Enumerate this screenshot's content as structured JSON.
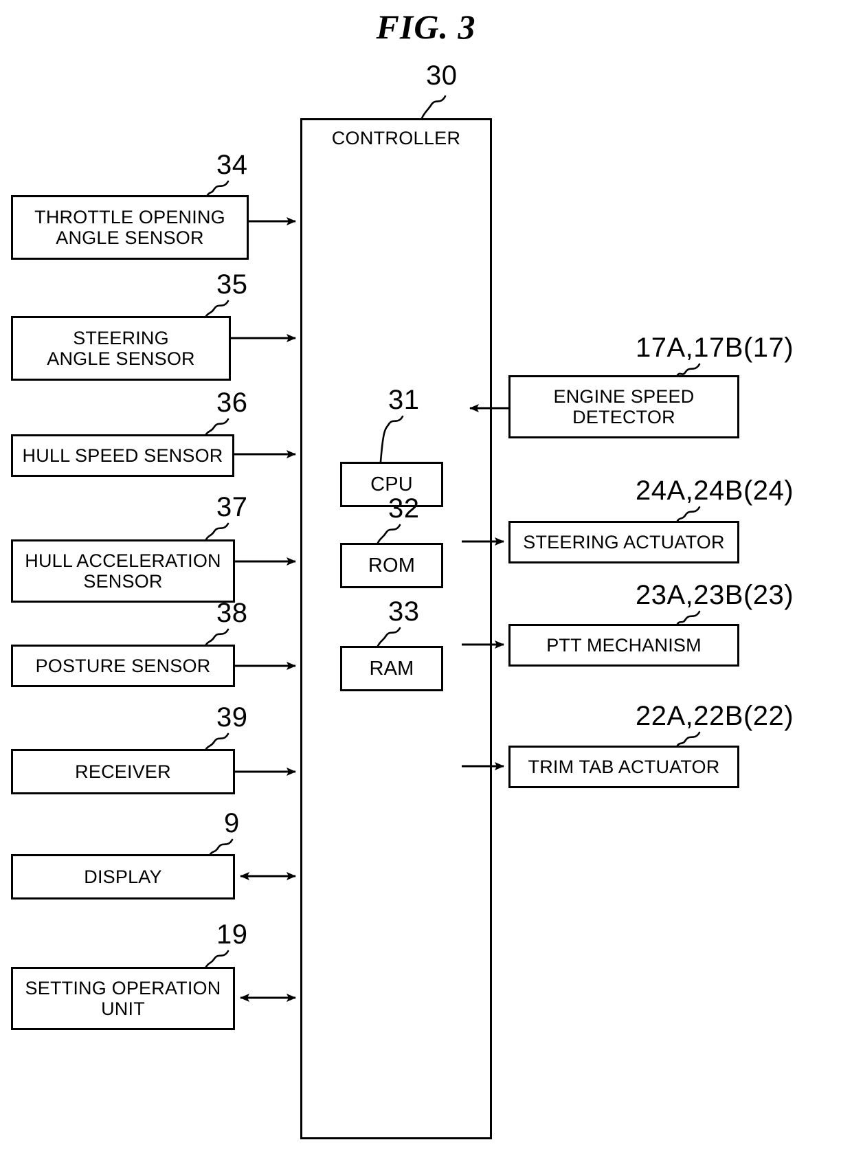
{
  "figure": {
    "title": "FIG. 3",
    "controller": {
      "label": "CONTROLLER",
      "ref": "30"
    }
  },
  "internal_units": [
    {
      "label": "CPU",
      "ref": "31"
    },
    {
      "label": "ROM",
      "ref": "32"
    },
    {
      "label": "RAM",
      "ref": "33"
    }
  ],
  "inputs_left": [
    {
      "label": "THROTTLE OPENING\nANGLE SENSOR",
      "ref": "34",
      "direction": "to-controller"
    },
    {
      "label": "STEERING\nANGLE SENSOR",
      "ref": "35",
      "direction": "to-controller"
    },
    {
      "label": "HULL SPEED SENSOR",
      "ref": "36",
      "direction": "to-controller"
    },
    {
      "label": "HULL ACCELERATION\nSENSOR",
      "ref": "37",
      "direction": "to-controller"
    },
    {
      "label": "POSTURE SENSOR",
      "ref": "38",
      "direction": "to-controller"
    },
    {
      "label": "RECEIVER",
      "ref": "39",
      "direction": "to-controller"
    },
    {
      "label": "DISPLAY",
      "ref": "9",
      "direction": "bidirectional"
    },
    {
      "label": "SETTING OPERATION\nUNIT",
      "ref": "19",
      "direction": "bidirectional"
    }
  ],
  "peripherals_right": [
    {
      "label": "ENGINE SPEED\nDETECTOR",
      "ref": "17A,17B(17)",
      "direction": "to-controller"
    },
    {
      "label": "STEERING ACTUATOR",
      "ref": "24A,24B(24)",
      "direction": "from-controller"
    },
    {
      "label": "PTT MECHANISM",
      "ref": "23A,23B(23)",
      "direction": "from-controller"
    },
    {
      "label": "TRIM TAB ACTUATOR",
      "ref": "22A,22B(22)",
      "direction": "from-controller"
    }
  ],
  "colors": {
    "ink": "#000000",
    "paper": "#ffffff"
  }
}
